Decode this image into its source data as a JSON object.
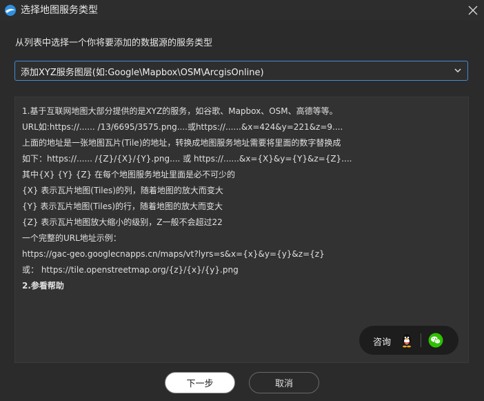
{
  "window": {
    "title": "选择地图服务类型",
    "logo_icon": "globe-icon",
    "close_icon": "close-icon"
  },
  "prompt": "从列表中选择一个你将要添加的数据源的服务类型",
  "service_select": {
    "value": "添加XYZ服务图层(如:Google\\Mapbox\\OSM\\ArcgisOnline)",
    "icon": "chevron-down-icon",
    "accent": "#3f8fd8"
  },
  "info": {
    "lines": [
      "1.基于互联网地图大部分提供的是XYZ的服务，如谷歌、Mapbox、OSM、高德等等。",
      "URL如:https://...... /13/6695/3575.png....或https://......&x=424&y=221&z=9....",
      "上面的地址是一张地图瓦片(Tile)的地址，转换成地图服务地址需要将里面的数字替换成",
      "如下：https://...... /{Z}/{X}/{Y}.png.... 或 https://......&x={X}&y={Y}&z={Z}....",
      "其中{X} {Y} {Z} 在每个地图服务地址里面是必不可少的",
      "{X} 表示瓦片地图(Tiles)的列，随着地图的放大而变大",
      "{Y} 表示瓦片地图(Tiles)的行，随着地图的放大而变大",
      "{Z} 表示瓦片地图放大缩小的级别，Z一般不会超过22",
      "一个完整的URL地址示例：",
      "https://gac-geo.googlecnapps.cn/maps/vt?lyrs=s&x={x}&y={y}&z={z}",
      "或： https://tile.openstreetmap.org/{z}/{x}/{y}.png",
      "2.参看帮助"
    ]
  },
  "consult": {
    "label": "咨询",
    "qq_icon": "qq-icon",
    "wechat_icon": "wechat-icon"
  },
  "buttons": {
    "next": "下一步",
    "cancel": "取消"
  }
}
